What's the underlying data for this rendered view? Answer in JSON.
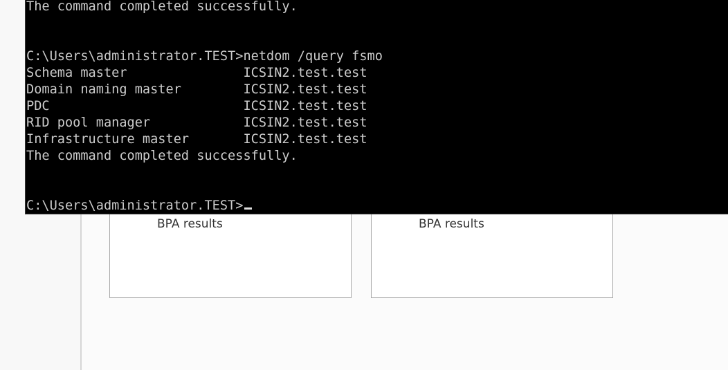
{
  "server_manager": {
    "tiles": [
      {
        "label": "BPA results"
      },
      {
        "label": "BPA results"
      }
    ]
  },
  "console": {
    "lines": [
      "The command completed successfully.",
      "",
      "",
      "C:\\Users\\administrator.TEST>netdom /query fsmo",
      "Schema master               ICSIN2.test.test",
      "Domain naming master        ICSIN2.test.test",
      "PDC                         ICSIN2.test.test",
      "RID pool manager            ICSIN2.test.test",
      "Infrastructure master       ICSIN2.test.test",
      "The command completed successfully.",
      "",
      ""
    ],
    "prompt": "C:\\Users\\administrator.TEST>"
  }
}
